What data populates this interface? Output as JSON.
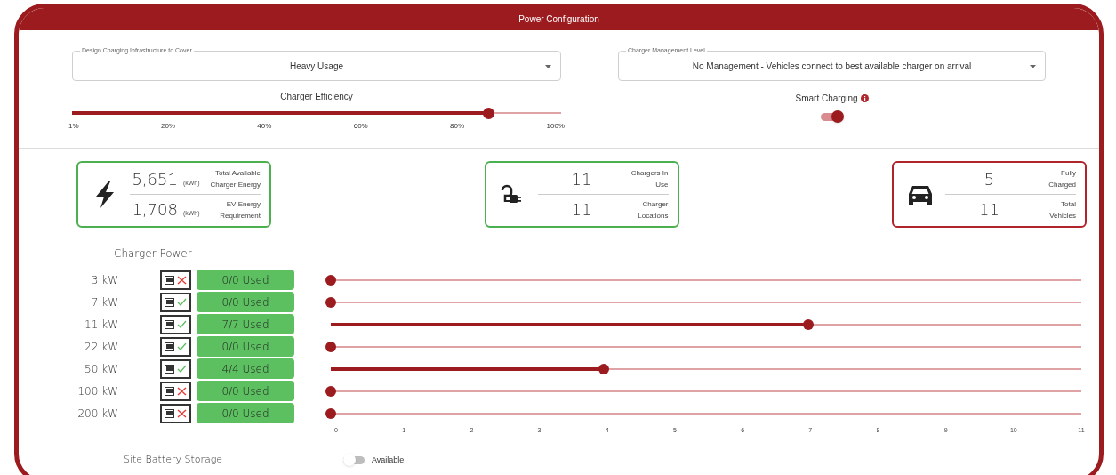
{
  "header": {
    "title": "Power Configuration"
  },
  "infrastructure_select": {
    "label": "Design Charging Infrastructure to Cover",
    "value": "Heavy Usage"
  },
  "management_select": {
    "label": "Charger Management Level",
    "value": "No Management - Vehicles connect to best available charger on arrival"
  },
  "efficiency": {
    "label": "Charger Efficiency",
    "level": 0.85,
    "ticks": [
      "1%",
      "20%",
      "40%",
      "60%",
      "80%",
      "100%"
    ]
  },
  "smart_charging": {
    "label": "Smart Charging",
    "on": true
  },
  "cards": [
    {
      "kind": "energy",
      "color": "#4caf50",
      "top_value": "5,651",
      "top_unit": "(kWh)",
      "top_label": "Total Available Charger Energy",
      "bottom_value": "1,708",
      "bottom_unit": "(kWh)",
      "bottom_label": "EV Energy Requirement"
    },
    {
      "kind": "chargers",
      "color": "#4caf50",
      "top_value": "11",
      "top_label": "Chargers In Use",
      "bottom_value": "11",
      "bottom_label": "Charger Locations"
    },
    {
      "kind": "vehicles",
      "color": "#b0252b",
      "top_value": "5",
      "top_label": "Fully Charged",
      "bottom_value": "11",
      "bottom_label": "Total Vehicles"
    }
  ],
  "charger_power": {
    "title": "Charger Power",
    "rows": [
      {
        "label": "3 kW",
        "available": false,
        "used": "0/0 Used",
        "level": 0
      },
      {
        "label": "7 kW",
        "available": true,
        "used": "0/0 Used",
        "level": 0
      },
      {
        "label": "11 kW",
        "available": true,
        "used": "7/7 Used",
        "level": 0.636
      },
      {
        "label": "22 kW",
        "available": true,
        "used": "0/0 Used",
        "level": 0
      },
      {
        "label": "50 kW",
        "available": true,
        "used": "4/4 Used",
        "level": 0.364
      },
      {
        "label": "100 kW",
        "available": false,
        "used": "0/0 Used",
        "level": 0
      },
      {
        "label": "200 kW",
        "available": false,
        "used": "0/0 Used",
        "level": 0
      }
    ],
    "axis": [
      "0",
      "1",
      "2",
      "3",
      "4",
      "5",
      "6",
      "7",
      "8",
      "9",
      "10",
      "11"
    ]
  },
  "battery": {
    "label": "Site Battery Storage",
    "toggle_label": "Available",
    "on": false
  }
}
